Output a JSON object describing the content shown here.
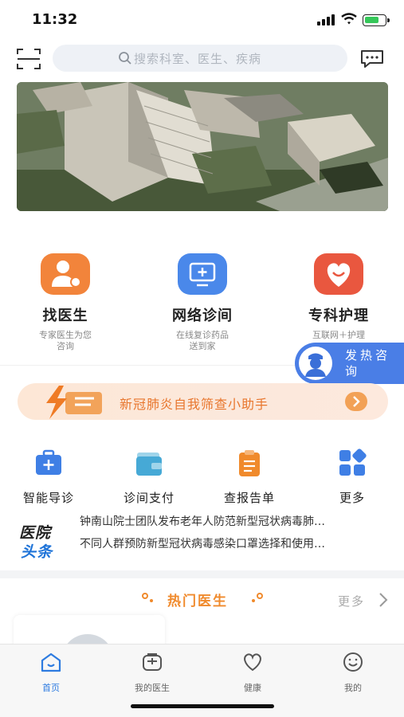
{
  "status": {
    "time": "11:32"
  },
  "search": {
    "placeholder": "搜索科室、医生、疾病"
  },
  "services": [
    {
      "title": "找医生",
      "subtitle_1": "专家医生为您",
      "subtitle_2": "咨询",
      "icon": "doctor-icon",
      "color": "#f2843b"
    },
    {
      "title": "网络诊间",
      "subtitle_1": "在线复诊药品",
      "subtitle_2": "送到家",
      "icon": "monitor-plus-icon",
      "color": "#4a88ea"
    },
    {
      "title": "专科护理",
      "subtitle_1": "互联网＋护理",
      "subtitle_2": "",
      "icon": "heart-icon",
      "color": "#e9573f"
    }
  ],
  "fever": {
    "text": "发热咨询"
  },
  "covid": {
    "text": "新冠肺炎自我筛查小助手"
  },
  "quick": [
    {
      "label": "智能导诊",
      "icon": "medical-kit-icon",
      "color": "#3f7fe5"
    },
    {
      "label": "诊间支付",
      "icon": "wallet-icon",
      "color": "#46a9d6"
    },
    {
      "label": "查报告单",
      "icon": "clipboard-icon",
      "color": "#f08a2c"
    },
    {
      "label": "更多",
      "icon": "grid-icon",
      "color": "#3f7fe5"
    }
  ],
  "news": {
    "logo_line1": "医院",
    "logo_line2": "头条",
    "items": [
      "钟南山院士团队发布老年人防范新型冠状病毒肺…",
      "不同人群预防新型冠状病毒感染口罩选择和使用…"
    ]
  },
  "hot": {
    "title": "热门医生",
    "more": "更多"
  },
  "tabs": [
    {
      "label": "首页",
      "icon": "home-icon",
      "active": true
    },
    {
      "label": "我的医生",
      "icon": "doctor-bag-icon",
      "active": false
    },
    {
      "label": "健康",
      "icon": "heart-outline-icon",
      "active": false
    },
    {
      "label": "我的",
      "icon": "smile-icon",
      "active": false
    }
  ],
  "colors": {
    "accent": "#2d7be0",
    "orange": "#f08a2c"
  }
}
